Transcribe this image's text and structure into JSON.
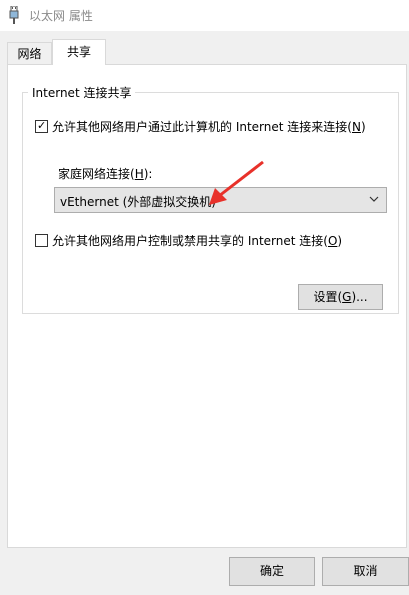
{
  "window": {
    "title": "以太网 属性",
    "icon": "network-adapter-icon"
  },
  "tabs": [
    {
      "label": "网络",
      "active": false
    },
    {
      "label": "共享",
      "active": true
    }
  ],
  "group": {
    "legend": "Internet 连接共享"
  },
  "allow_connect": {
    "checked": true,
    "label_prefix": "允许其他网络用户通过此计算机的 Internet 连接来连接(",
    "label_key": "N",
    "label_suffix": ")"
  },
  "home_network": {
    "label_prefix": "家庭网络连接(",
    "label_key": "H",
    "label_suffix": "):",
    "selected_value": "vEthernet (外部虚拟交换机)"
  },
  "allow_control": {
    "checked": false,
    "label_prefix": "允许其他网络用户控制或禁用共享的 Internet 连接(",
    "label_key": "O",
    "label_suffix": ")"
  },
  "buttons": {
    "settings_prefix": "设置(",
    "settings_key": "G",
    "settings_suffix": ")...",
    "ok": "确定",
    "cancel": "取消"
  },
  "colors": {
    "annotation_arrow": "#e8312a",
    "window_bg": "#f0f0f0",
    "panel_bg": "#ffffff"
  }
}
